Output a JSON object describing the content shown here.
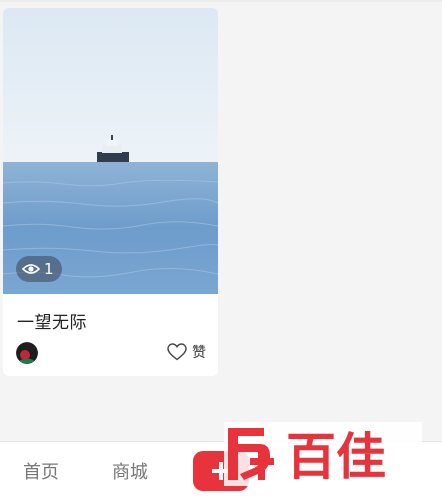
{
  "post": {
    "title": "一望无际",
    "views": "1",
    "like_label": "赞"
  },
  "tabbar": {
    "home_label": "首页",
    "mall_label": "商城"
  },
  "watermark": {
    "text": "百佳"
  },
  "colors": {
    "accent": "#e8323c",
    "sea": "#6f9fcd",
    "sky": "#e6eff7"
  },
  "icons": {
    "view": "eye-icon",
    "like": "heart-outline-icon",
    "add": "plus-icon"
  }
}
